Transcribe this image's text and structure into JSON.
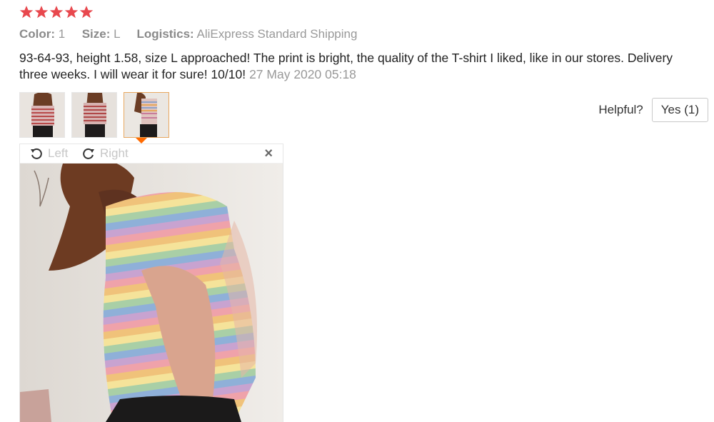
{
  "rating": {
    "stars": 5,
    "max": 5,
    "color": "#e8484e"
  },
  "meta": {
    "color_key": "Color:",
    "color_val": "1",
    "size_key": "Size:",
    "size_val": "L",
    "logistics_key": "Logistics:",
    "logistics_val": "AliExpress Standard Shipping"
  },
  "review": {
    "text": "93-64-93, height 1.58, size L approached! The print is bright, the quality of the T-shirt I liked, like in our stores. Delivery three weeks. I will wear it for sure! 10/10!",
    "date": "27 May 2020 05:18"
  },
  "viewer": {
    "rotate_left": "Left",
    "rotate_right": "Right",
    "close": "×"
  },
  "helpful": {
    "label": "Helpful?",
    "yes_button": "Yes (1)"
  },
  "accent": "#ff6a00"
}
